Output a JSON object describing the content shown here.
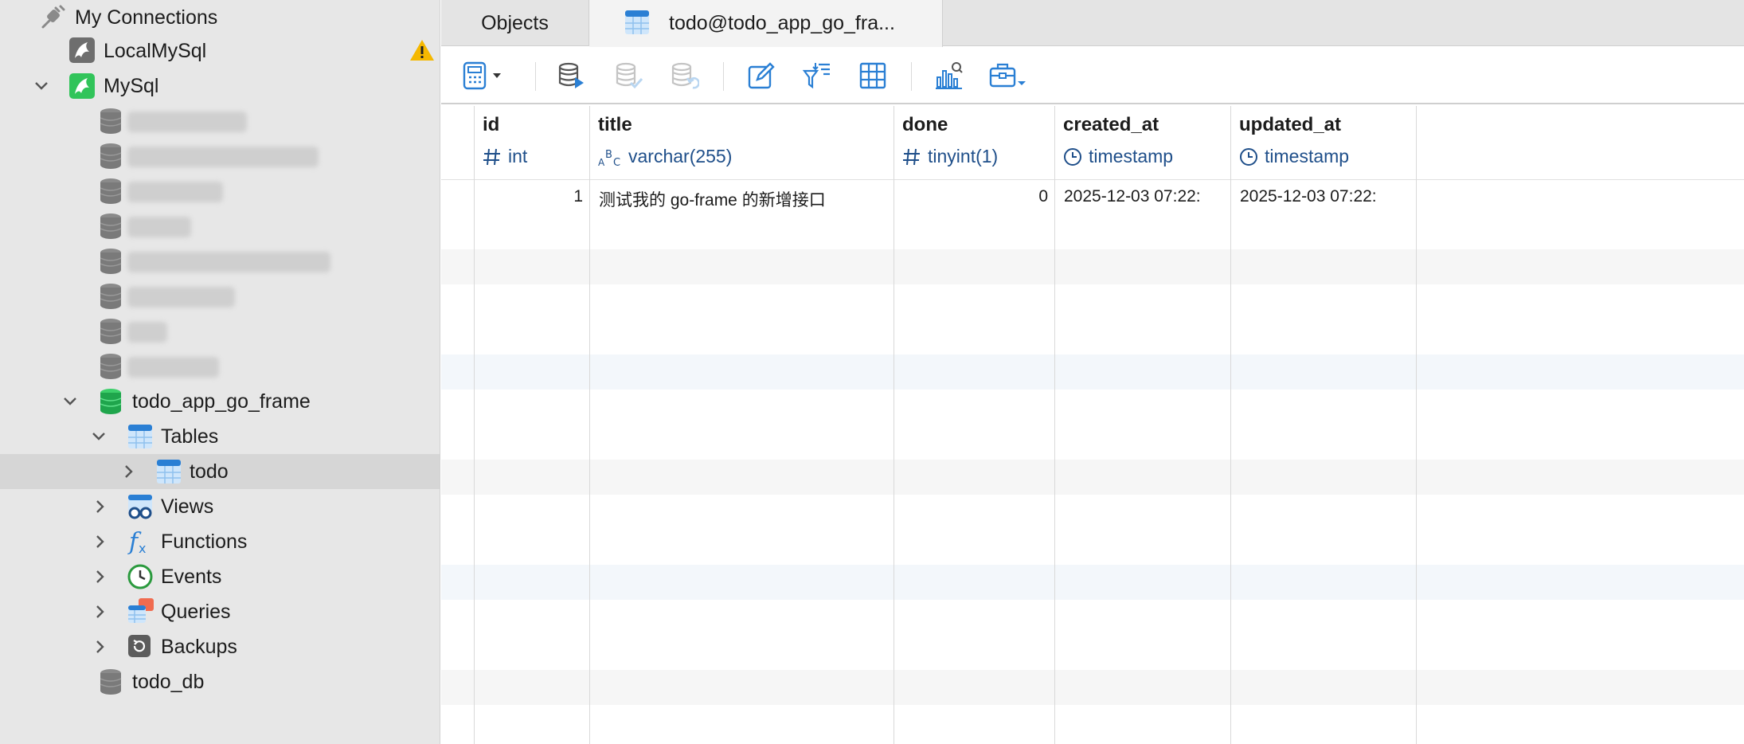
{
  "sidebar": {
    "my_connections": "My Connections",
    "local_mysql": "LocalMySql",
    "mysql": "MySql",
    "db_todo_app": "todo_app_go_frame",
    "tables": "Tables",
    "todo": "todo",
    "views": "Views",
    "functions": "Functions",
    "events": "Events",
    "queries": "Queries",
    "backups": "Backups",
    "todo_db": "todo_db"
  },
  "tabs": {
    "objects": "Objects",
    "todo": "todo@todo_app_go_fra..."
  },
  "grid": {
    "columns": [
      {
        "name": "id",
        "type": "int",
        "type_icon": "hash-icon"
      },
      {
        "name": "title",
        "type": "varchar(255)",
        "type_icon": "text-abc-icon"
      },
      {
        "name": "done",
        "type": "tinyint(1)",
        "type_icon": "hash-icon"
      },
      {
        "name": "created_at",
        "type": "timestamp",
        "type_icon": "clock-icon"
      },
      {
        "name": "updated_at",
        "type": "timestamp",
        "type_icon": "clock-icon"
      }
    ],
    "rows": [
      {
        "id": "1",
        "title": "测试我的 go-frame 的新增接口",
        "done": "0",
        "created_at": "2025-12-03 07:22:",
        "updated_at": "2025-12-03 07:22:"
      }
    ]
  },
  "colors": {
    "accent": "#2a7fd4",
    "type_text": "#1f4f8a",
    "warning": "#f5b800"
  }
}
